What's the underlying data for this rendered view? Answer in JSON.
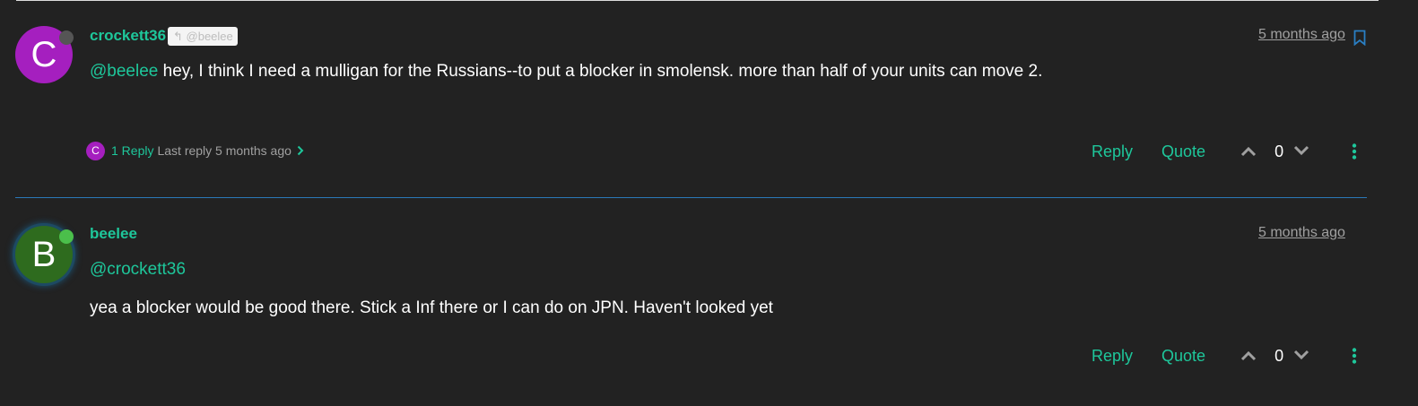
{
  "posts": [
    {
      "avatar_letter": "C",
      "avatar_color": "#a51fbf",
      "status": "offline",
      "username": "crockett36",
      "parent_badge": "@beelee",
      "timeago": "5 months ago",
      "mention": "@beelee",
      "text": " hey, I think I need a mulligan for the Russians--to put a blocker in smolensk. more than half of your units can move 2.",
      "replies": {
        "avatar_letter": "C",
        "count_label": "1 Reply",
        "last_reply": "Last reply 5 months ago"
      },
      "actions": {
        "reply": "Reply",
        "quote": "Quote",
        "votes": "0"
      }
    },
    {
      "avatar_letter": "B",
      "avatar_color": "#2e6b1e",
      "status": "online",
      "username": "beelee",
      "timeago": "5 months ago",
      "mention": "@crockett36",
      "text": "yea a blocker would be good there. Stick a Inf there or I can do on JPN. Haven't looked yet",
      "actions": {
        "reply": "Reply",
        "quote": "Quote",
        "votes": "0"
      }
    }
  ],
  "icons": {
    "status_offline": "status-offline-icon",
    "status_online": "status-online-icon",
    "bookmark": "bookmark-icon",
    "reply_arrow": "reply-arrow-icon",
    "chevron_right": "chevron-right-icon",
    "upvote": "chevron-up-icon",
    "downvote": "chevron-down-icon",
    "menu": "vertical-dots-icon"
  },
  "colors": {
    "accent": "#1ec79b",
    "background": "#222222",
    "muted": "#a0a0a0",
    "divider": "#2a79b8"
  }
}
